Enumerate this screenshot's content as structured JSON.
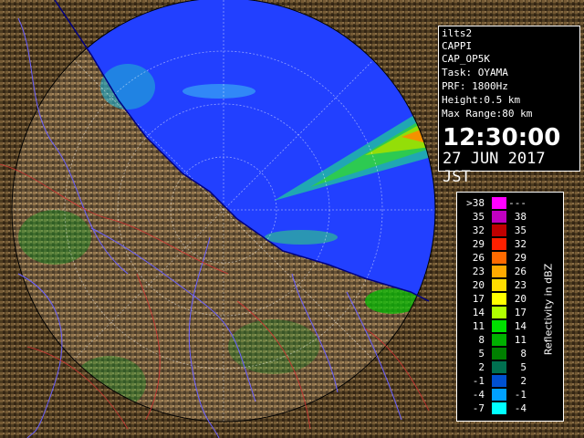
{
  "info": {
    "lines": [
      "ilts2",
      "CAPPI",
      "CAP_OP5K",
      "Task: OYAMA",
      "PRF: 1800Hz",
      "Height:0.5 km",
      "Max Range:80 km"
    ],
    "time": "12:30:00",
    "date": "27 JUN 2017 JST"
  },
  "legend": {
    "title": "Reflectivity in dBZ",
    "rows": [
      {
        "left": ">38",
        "right": "---",
        "color": "#ff00ff"
      },
      {
        "left": "35",
        "right": "38",
        "color": "#c000c0"
      },
      {
        "left": "32",
        "right": "35",
        "color": "#c00000"
      },
      {
        "left": "29",
        "right": "32",
        "color": "#ff2000"
      },
      {
        "left": "26",
        "right": "29",
        "color": "#ff6a00"
      },
      {
        "left": "23",
        "right": "26",
        "color": "#ffaa00"
      },
      {
        "left": "20",
        "right": "23",
        "color": "#ffdd00"
      },
      {
        "left": "17",
        "right": "20",
        "color": "#ffff00"
      },
      {
        "left": "14",
        "right": "17",
        "color": "#b0ff00"
      },
      {
        "left": "11",
        "right": "14",
        "color": "#00e000"
      },
      {
        "left": "8",
        "right": "11",
        "color": "#00b000"
      },
      {
        "left": "5",
        "right": "8",
        "color": "#008000"
      },
      {
        "left": "2",
        "right": "5",
        "color": "#007050"
      },
      {
        "left": "-1",
        "right": "2",
        "color": "#0050d0"
      },
      {
        "left": "-4",
        "right": "-1",
        "color": "#00a0ff"
      },
      {
        "left": "-7",
        "right": "-4",
        "color": "#00ffff"
      }
    ]
  },
  "colors": {
    "sea": "#0a1aff",
    "land": "#6b4e2a",
    "outside": "#000000"
  }
}
